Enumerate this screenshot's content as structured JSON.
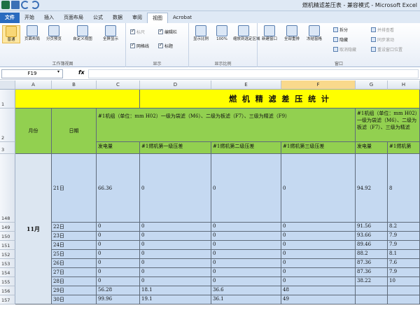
{
  "window": {
    "title": "燃机精滤差压表 - 兼容模式 - Microsoft Excel"
  },
  "tabs": [
    "文件",
    "开始",
    "插入",
    "页面布局",
    "公式",
    "数据",
    "审阅",
    "视图",
    "Acrobat"
  ],
  "ribbon": {
    "workbook_views": {
      "label": "工作簿视图",
      "buttons": [
        "普通",
        "页面布局",
        "分页预览",
        "自定义视图",
        "全屏显示"
      ]
    },
    "show": {
      "label": "显示",
      "checks": [
        {
          "text": "标尺",
          "checked": true,
          "dim": true
        },
        {
          "text": "编辑栏",
          "checked": true,
          "dim": false
        },
        {
          "text": "网格线",
          "checked": true,
          "dim": false
        },
        {
          "text": "标题",
          "checked": true,
          "dim": false
        }
      ]
    },
    "zoom": {
      "label": "显示比例",
      "buttons": [
        "显示比例",
        "100%",
        "缩放到选定区域"
      ]
    },
    "window_group": {
      "label": "窗口",
      "buttons": [
        "新建窗口",
        "全部重排",
        "冻结窗格"
      ],
      "small": [
        {
          "text": "拆分",
          "dim": false
        },
        {
          "text": "隐藏",
          "dim": false
        },
        {
          "text": "取消隐藏",
          "dim": true
        },
        {
          "text": "并排查看",
          "dim": true
        },
        {
          "text": "同步滚动",
          "dim": true
        },
        {
          "text": "重设窗口位置",
          "dim": true
        }
      ]
    }
  },
  "formula_bar": {
    "name_box": "F19",
    "fx": "fx",
    "value": ""
  },
  "columns": [
    "A",
    "B",
    "C",
    "D",
    "E",
    "F",
    "G",
    "H"
  ],
  "selected_column": "F",
  "rows": [
    "1",
    "2",
    "3",
    "148",
    "149",
    "150",
    "151",
    "152",
    "153",
    "154",
    "155",
    "156",
    "157"
  ],
  "sheet": {
    "title": "燃 机 精 滤 差 压 统 计",
    "month_label": "月份",
    "date_label": "日期",
    "header_unit1": "#1机组（单位：mm H02）一级为袋滤（M6）、二级为板滤（F7）、三级为精滤（F9）",
    "header_unit2": "#1机组（单位：mm H02）一级为袋滤（M6）、二级为板滤（F7）、三级为精滤",
    "sub_headers": [
      "发电量",
      "#1燃机第一级压差",
      "#1燃机第二级压差",
      "#1燃机第三级压差",
      "发电量",
      "#1燃机第"
    ],
    "month": "11月",
    "data_rows": [
      {
        "date": "21日",
        "c": "66.36",
        "d": "0",
        "e": "0",
        "f": "0",
        "g": "94.92",
        "h": "8"
      },
      {
        "date": "22日",
        "c": "0",
        "d": "0",
        "e": "0",
        "f": "0",
        "g": "91.56",
        "h": "8.2"
      },
      {
        "date": "23日",
        "c": "0",
        "d": "0",
        "e": "0",
        "f": "0",
        "g": "93.66",
        "h": "7.9"
      },
      {
        "date": "24日",
        "c": "0",
        "d": "0",
        "e": "0",
        "f": "0",
        "g": "89.46",
        "h": "7.9"
      },
      {
        "date": "25日",
        "c": "0",
        "d": "0",
        "e": "0",
        "f": "0",
        "g": "88.2",
        "h": "8.1"
      },
      {
        "date": "26日",
        "c": "0",
        "d": "0",
        "e": "0",
        "f": "0",
        "g": "87.36",
        "h": "7.6"
      },
      {
        "date": "27日",
        "c": "0",
        "d": "0",
        "e": "0",
        "f": "0",
        "g": "87.36",
        "h": "7.9"
      },
      {
        "date": "28日",
        "c": "0",
        "d": "0",
        "e": "0",
        "f": "0",
        "g": "38.22",
        "h": "10"
      },
      {
        "date": "29日",
        "c": "56.28",
        "d": "18.1",
        "e": "36.6",
        "f": "48",
        "g": "",
        "h": ""
      },
      {
        "date": "30日",
        "c": "99.96",
        "d": "19.1",
        "e": "36.1",
        "f": "49",
        "g": "",
        "h": ""
      }
    ]
  },
  "colors": {
    "yellow": "#ffff00",
    "green": "#92d050",
    "blue": "#c5d9f1",
    "file_tab": "#2a6bbf"
  }
}
